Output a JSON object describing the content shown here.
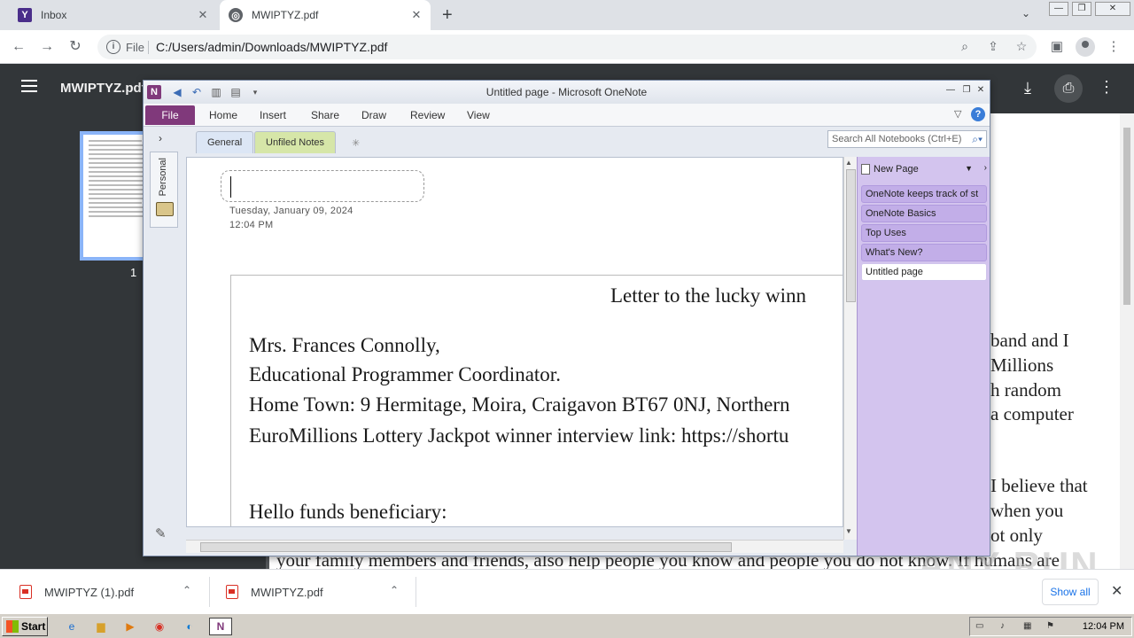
{
  "browser": {
    "tabs": [
      {
        "title": "Inbox",
        "icon": "Y"
      },
      {
        "title": "MWIPTYZ.pdf",
        "icon": "globe"
      }
    ],
    "address": {
      "scheme_label": "File",
      "url": "C:/Users/admin/Downloads/MWIPTYZ.pdf"
    }
  },
  "pdf": {
    "title": "MWIPTYZ.pdf",
    "page_number": "1",
    "visible_text": [
      "band and I",
      "Millions",
      "h random",
      "a computer",
      "I believe that",
      "when you",
      "ot only",
      "your family members and friends, also help people you know and people you do not know. If humans are"
    ]
  },
  "downloads": {
    "items": [
      {
        "name": "MWIPTYZ (1).pdf"
      },
      {
        "name": "MWIPTYZ.pdf"
      }
    ],
    "show_all": "Show all"
  },
  "taskbar": {
    "start_label": "Start",
    "time": "12:04 PM"
  },
  "onenote": {
    "window_title": "Untitled page - Microsoft OneNote",
    "ribbon_tabs": {
      "file": "File",
      "home": "Home",
      "insert": "Insert",
      "share": "Share",
      "draw": "Draw",
      "review": "Review",
      "view": "View"
    },
    "notebook": "Personal",
    "sections": {
      "general": "General",
      "unfiled": "Unfiled Notes"
    },
    "search_placeholder": "Search All Notebooks (Ctrl+E)",
    "page": {
      "date": "Tuesday, January 09, 2024",
      "time": "12:04 PM"
    },
    "printout_lines": {
      "top": "Letter to the lucky winn",
      "l1": "Mrs. Frances Connolly,",
      "l2": "Educational Programmer Coordinator.",
      "l3": "Home Town: 9 Hermitage, Moira, Craigavon BT67 0NJ, Northern",
      "l4": "EuroMillions Lottery Jackpot winner interview link: https://shortu",
      "l5": "Hello funds beneficiary:"
    },
    "new_page": "New Page",
    "pages": [
      {
        "title": "OneNote keeps track of st"
      },
      {
        "title": "OneNote Basics"
      },
      {
        "title": "Top Uses"
      },
      {
        "title": "What's New?"
      },
      {
        "title": "Untitled page"
      }
    ]
  },
  "watermark": "ANY RUN"
}
